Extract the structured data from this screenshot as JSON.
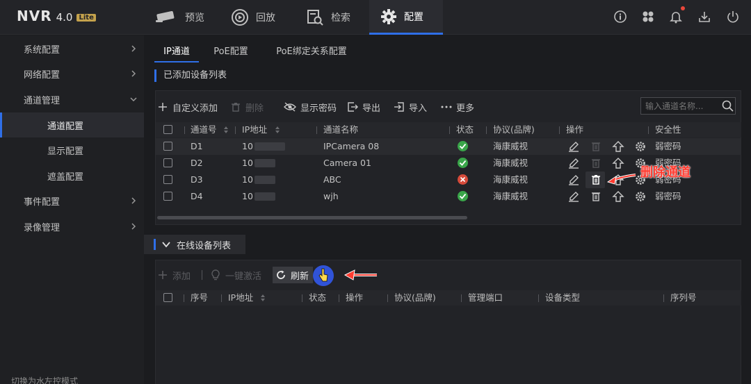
{
  "app": {
    "logo_main": "NVR",
    "logo_version": "4.0",
    "logo_edition": "Lite"
  },
  "nav": {
    "preview": "预览",
    "playback": "回放",
    "search": "检索",
    "config": "配置"
  },
  "sidebar": {
    "items": [
      {
        "label": "系统配置"
      },
      {
        "label": "网络配置"
      },
      {
        "label": "通道管理"
      },
      {
        "label": "通道配置"
      },
      {
        "label": "显示配置"
      },
      {
        "label": "遮盖配置"
      },
      {
        "label": "事件配置"
      },
      {
        "label": "录像管理"
      }
    ],
    "bottom_text": "切换为水左控模式"
  },
  "subtabs": [
    "IP通道",
    "PoE配置",
    "PoE绑定关系配置"
  ],
  "added": {
    "title": "已添加设备列表",
    "toolbar": {
      "custom_add": "自定义添加",
      "delete": "删除",
      "show_password": "显示密码",
      "export": "导出",
      "import": "导入",
      "more": "更多"
    },
    "search_placeholder": "输入通道名称...",
    "columns": {
      "channel_no": "通道号",
      "ip": "IP地址",
      "name": "通道名称",
      "status": "状态",
      "protocol": "协议(品牌)",
      "operation": "操作",
      "security": "安全性"
    },
    "rows": [
      {
        "channel": "D1",
        "ip": "10",
        "name": "IPCamera 08",
        "status": "online",
        "protocol": "海康威视",
        "security": "弱密码"
      },
      {
        "channel": "D2",
        "ip": "10",
        "name": "Camera 01",
        "status": "online",
        "protocol": "海康威视",
        "security": "弱密码"
      },
      {
        "channel": "D3",
        "ip": "10",
        "name": "ABC",
        "status": "offline",
        "protocol": "海康威视",
        "security": "弱密码"
      },
      {
        "channel": "D4",
        "ip": "10",
        "name": "wjh",
        "status": "online",
        "protocol": "海康威视",
        "security": "弱密码"
      }
    ],
    "annotation": "删除通道"
  },
  "online": {
    "title": "在线设备列表",
    "toolbar": {
      "add": "添加",
      "one_click_activate": "一键激活",
      "refresh": "刷新"
    },
    "columns": {
      "seq": "序号",
      "ip": "IP地址",
      "status": "状态",
      "operation": "操作",
      "protocol": "协议(品牌)",
      "mgmt_port": "管理端口",
      "device_type": "设备类型",
      "serial": "序列号"
    }
  },
  "colors": {
    "accent": "#2f6fe8",
    "online": "#3aa64a",
    "offline": "#d64a3a",
    "annotation": "#ff3b30"
  }
}
